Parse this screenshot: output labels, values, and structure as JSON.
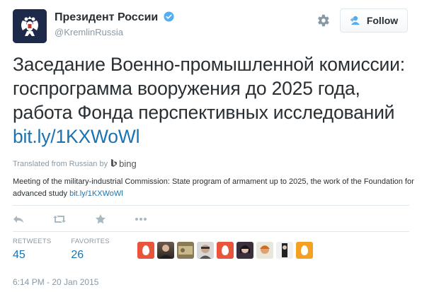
{
  "user": {
    "name": "Президент России",
    "handle": "@KremlinRussia"
  },
  "follow_button": {
    "label": "Follow"
  },
  "tweet": {
    "text": "Заседание Военно-промышленной комиссии: госпрограмма вооружения до 2025 года, работа Фонда перспективных исследований ",
    "link": "bit.ly/1KXWoWl"
  },
  "translation": {
    "attribution": "Translated from Russian by",
    "engine": "bing",
    "text": "Meeting of the military-industrial Commission: State program of armament up to 2025, the work of the Foundation for advanced study ",
    "link": "bit.ly/1KXWoWl"
  },
  "stats": {
    "retweets_label": "RETWEETS",
    "retweets": "45",
    "favorites_label": "FAVORITES",
    "favorites": "26"
  },
  "timestamp": "6:14 PM - 20 Jan 2015",
  "colors": {
    "link": "#1b73b0",
    "verified": "#55acee",
    "muted": "#8899a6"
  },
  "icons": [
    "gear-icon",
    "follow-person-icon",
    "verified-icon",
    "reply-icon",
    "retweet-icon",
    "favorite-icon",
    "more-icon",
    "bing-logo-icon"
  ]
}
